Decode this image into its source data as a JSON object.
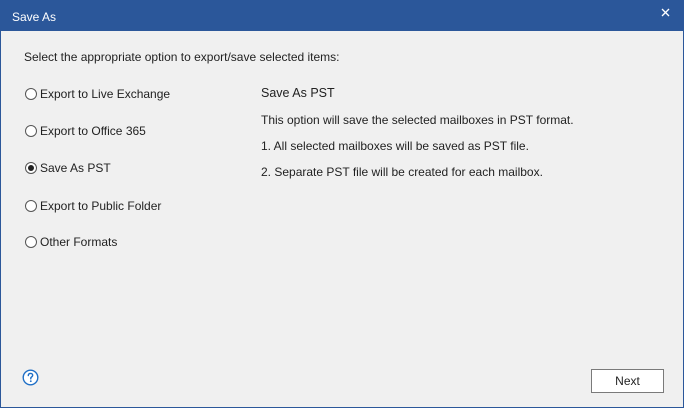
{
  "window": {
    "title": "Save As",
    "titlebar_color": "#2b579a",
    "close_icon": "close-icon"
  },
  "instruction": "Select the appropriate option to export/save selected items:",
  "options": [
    {
      "label": "Export to Live Exchange",
      "selected": false
    },
    {
      "label": "Export to Office 365",
      "selected": false
    },
    {
      "label": "Save As PST",
      "selected": true
    },
    {
      "label": "Export to Public Folder",
      "selected": false
    },
    {
      "label": "Other Formats",
      "selected": false
    }
  ],
  "description": {
    "title": "Save As PST",
    "line1": "This option will save the selected mailboxes in PST format.",
    "line2": "1. All selected mailboxes will be saved as PST file.",
    "line3": "2. Separate PST file will be created for each mailbox."
  },
  "footer": {
    "help_icon": "help-icon",
    "next_label": "Next"
  }
}
